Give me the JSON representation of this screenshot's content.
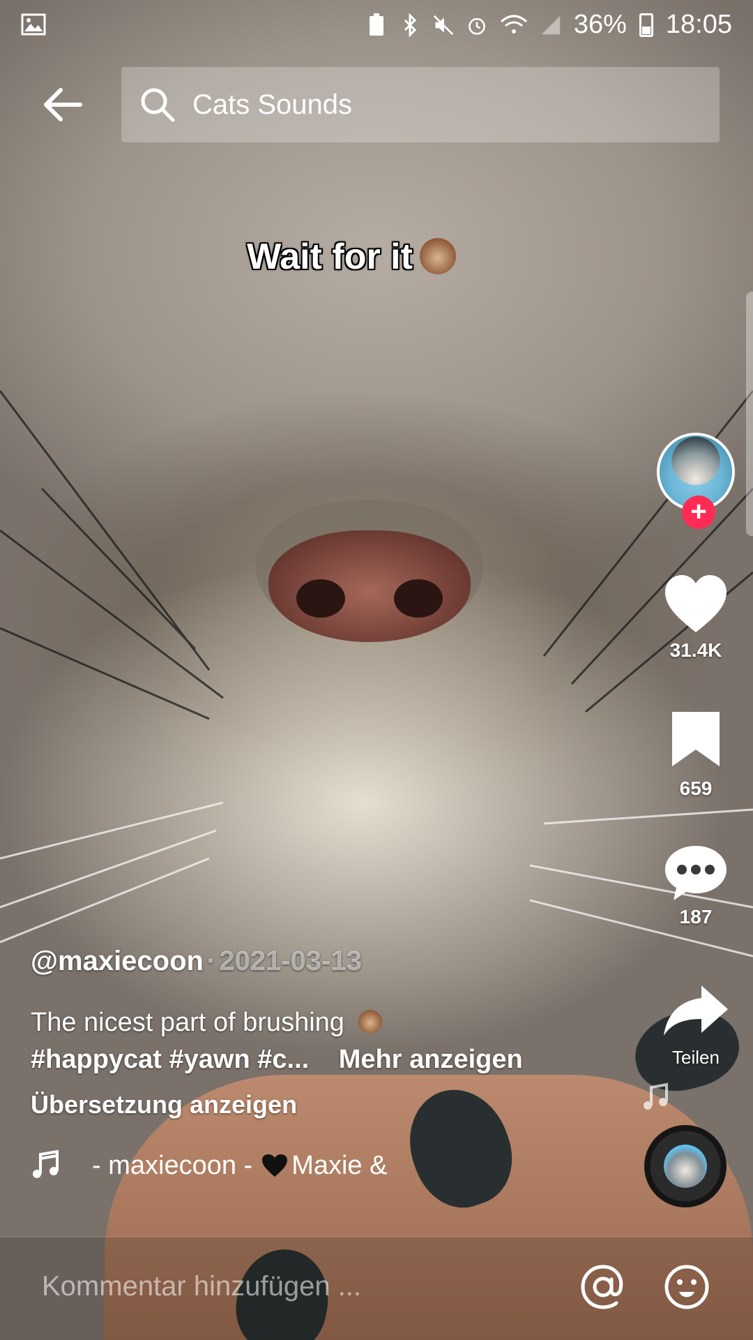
{
  "status_bar": {
    "battery": "36%",
    "time": "18:05"
  },
  "search": {
    "query": "Cats Sounds"
  },
  "video": {
    "caption": "Wait for it"
  },
  "actions": {
    "likes": "31.4K",
    "saves": "659",
    "comments": "187",
    "share_label": "Teilen"
  },
  "post": {
    "username": "@maxiecoon",
    "separator": "·",
    "date": "2021-03-13",
    "description": "The nicest part of brushing",
    "tags": "#happycat #yawn #c...",
    "more": "Mehr anzeigen",
    "translate": "Übersetzung anzeigen"
  },
  "music": {
    "prefix": "- maxiecoon -",
    "suffix": "Maxie &"
  },
  "comment_bar": {
    "placeholder": "Kommentar hinzufügen ..."
  },
  "icons": {
    "back": "arrow-left-icon",
    "search": "search-icon",
    "like": "heart-icon",
    "save": "bookmark-icon",
    "comment": "comment-dots-icon",
    "share": "share-arrow-icon",
    "music": "music-note-icon",
    "mention": "at-icon",
    "emoji": "smiley-icon"
  },
  "colors": {
    "accent": "#fe2c55",
    "text": "#ffffff"
  }
}
